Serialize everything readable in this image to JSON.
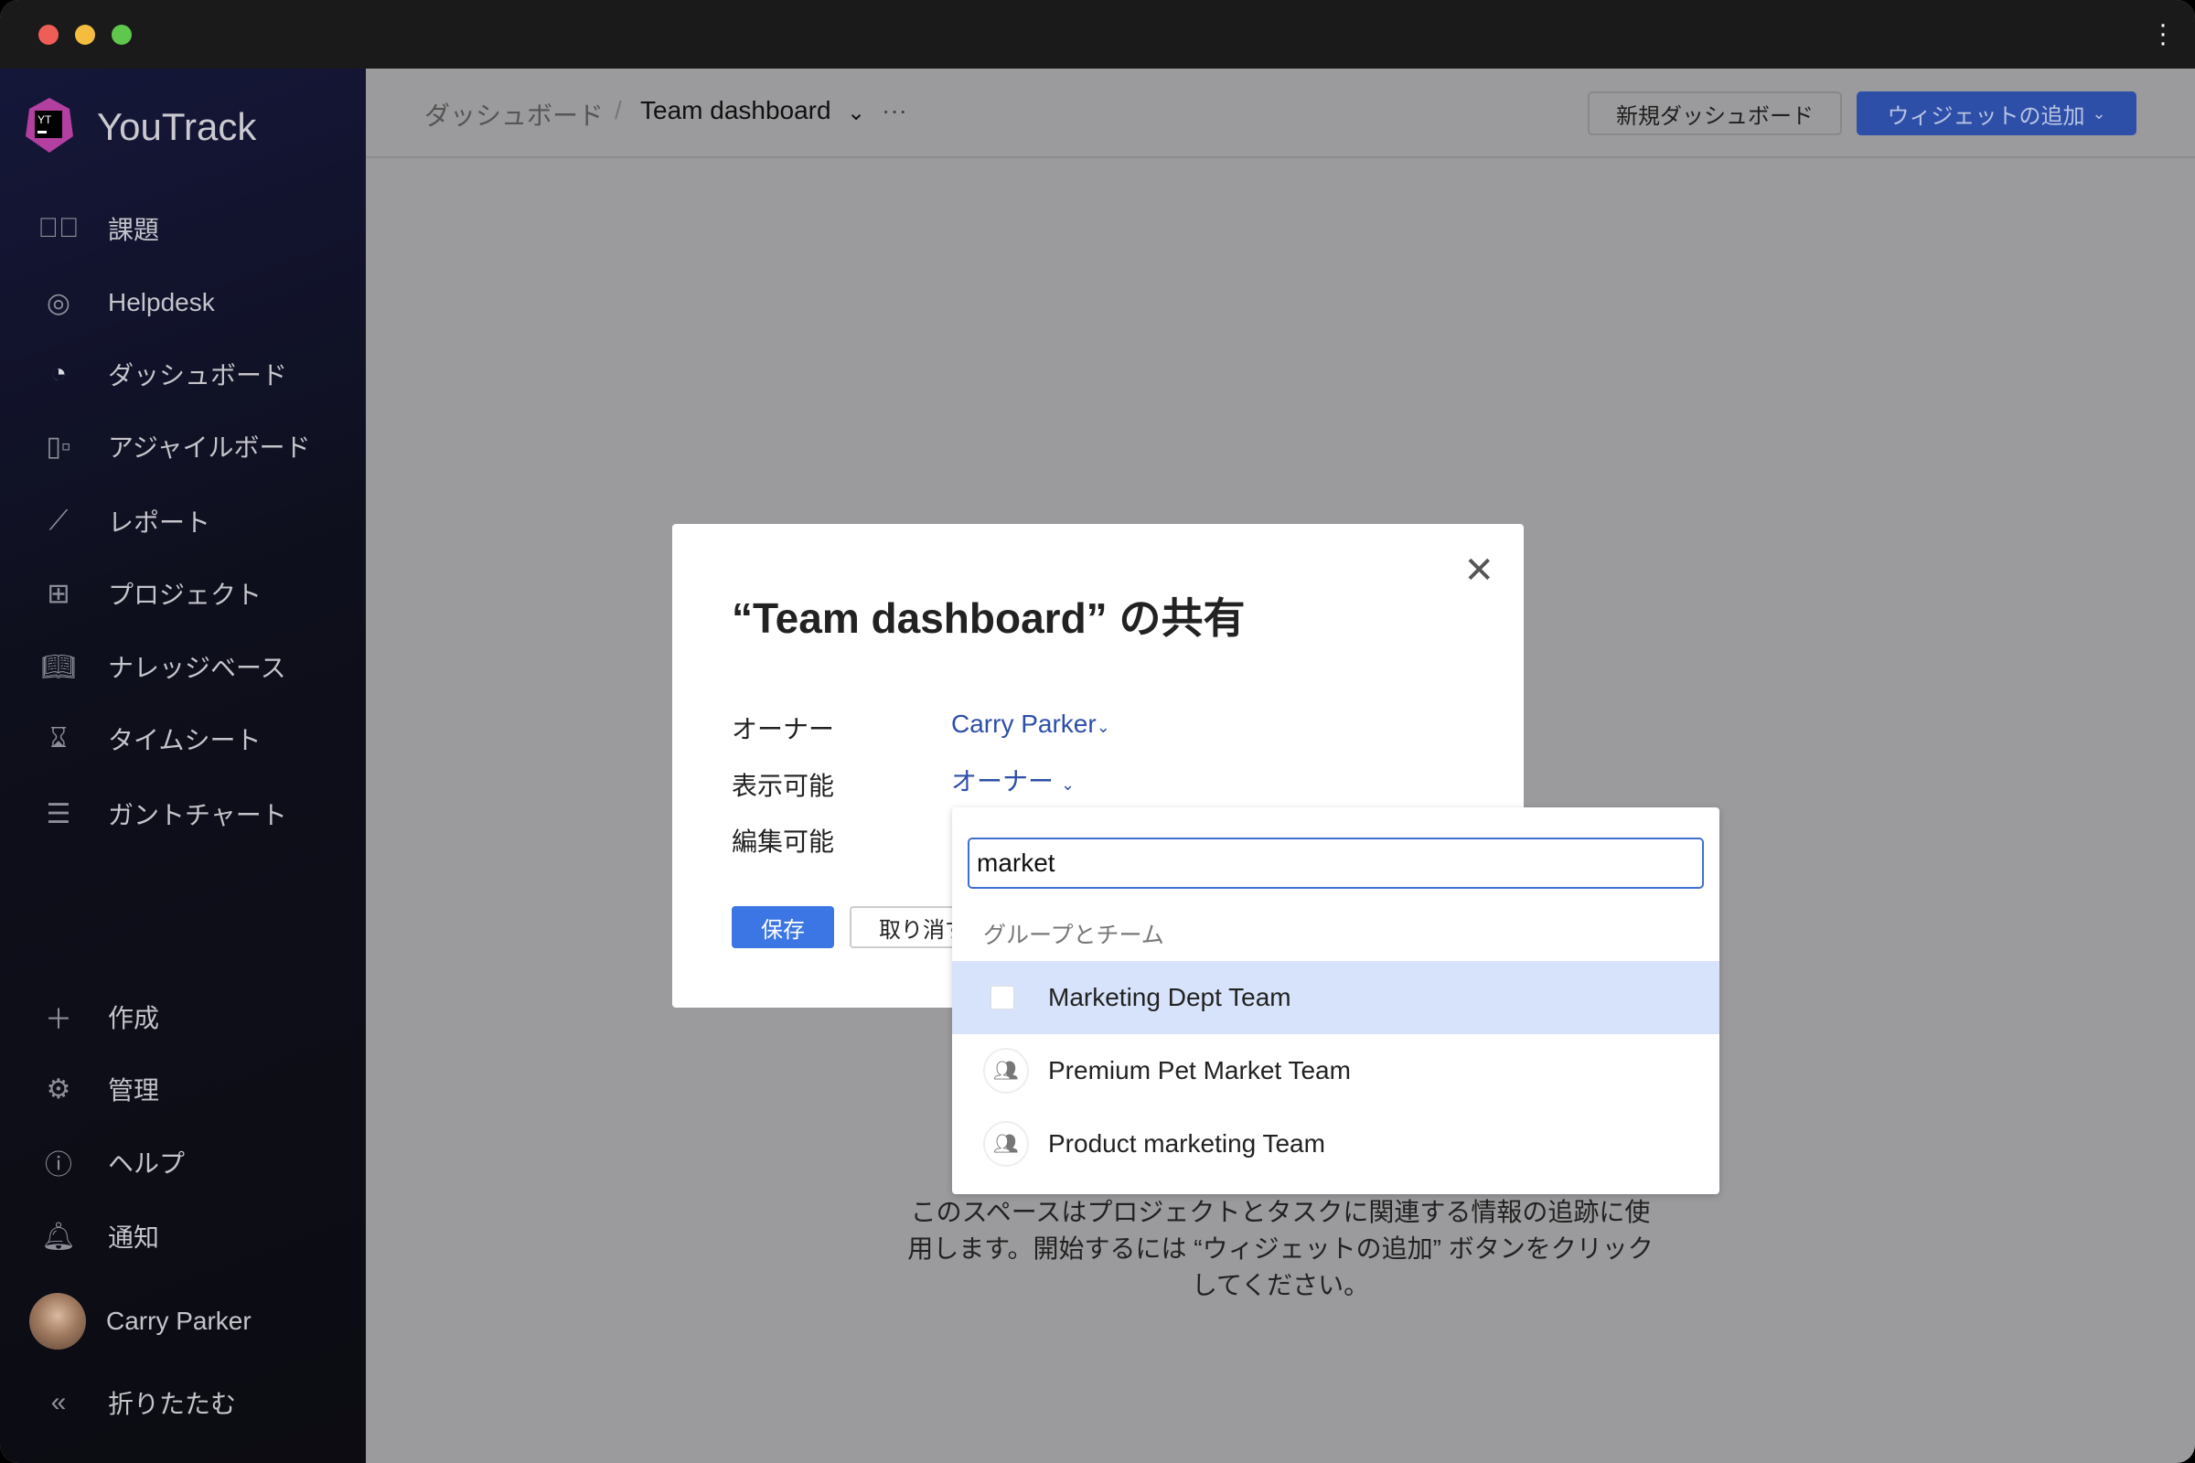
{
  "window": {
    "traffic_lights": [
      "#ee5e56",
      "#f5bd3f",
      "#5fc74c"
    ]
  },
  "sidebar": {
    "brand": "YouTrack",
    "items": [
      {
        "icon": "check-circle-icon",
        "label": "課題"
      },
      {
        "icon": "lifebuoy-icon",
        "label": "Helpdesk"
      },
      {
        "icon": "dashboard-icon",
        "label": "ダッシュボード"
      },
      {
        "icon": "agile-board-icon",
        "label": "アジャイルボード"
      },
      {
        "icon": "chart-icon",
        "label": "レポート"
      },
      {
        "icon": "grid-icon",
        "label": "プロジェクト"
      },
      {
        "icon": "book-icon",
        "label": "ナレッジベース"
      },
      {
        "icon": "hourglass-icon",
        "label": "タイムシート"
      },
      {
        "icon": "gantt-icon",
        "label": "ガントチャート"
      }
    ],
    "bottom": [
      {
        "icon": "plus-icon",
        "label": "作成"
      },
      {
        "icon": "gear-icon",
        "label": "管理"
      },
      {
        "icon": "help-icon",
        "label": "ヘルプ"
      },
      {
        "icon": "bell-icon",
        "label": "通知"
      }
    ],
    "user": "Carry Parker",
    "collapse": "折りたたむ"
  },
  "header": {
    "breadcrumb_root": "ダッシュボード",
    "breadcrumb_current": "Team dashboard",
    "new_dashboard": "新規ダッシュボード",
    "add_widget": "ウィジェットの追加",
    "accent": "#2e4fa8"
  },
  "dialog": {
    "title": "“Team dashboard” の共有",
    "owner_label": "オーナー",
    "owner_value": "Carry Parker",
    "visible_label": "表示可能",
    "visible_value": "オーナー",
    "edit_label": "編集可能",
    "save": "保存",
    "cancel": "取り消す"
  },
  "dropdown": {
    "search_value": "market",
    "section": "グループとチーム",
    "options": [
      {
        "label": "Marketing Dept Team",
        "type": "checkbox",
        "highlighted": true
      },
      {
        "label": "Premium Pet Market Team",
        "type": "group"
      },
      {
        "label": "Product marketing Team",
        "type": "group"
      }
    ]
  },
  "empty_text": "このスペースはプロジェクトとタスクに関連する情報の追跡に使用します。開始するには “ウィジェットの追加” ボタンをクリックしてください。"
}
